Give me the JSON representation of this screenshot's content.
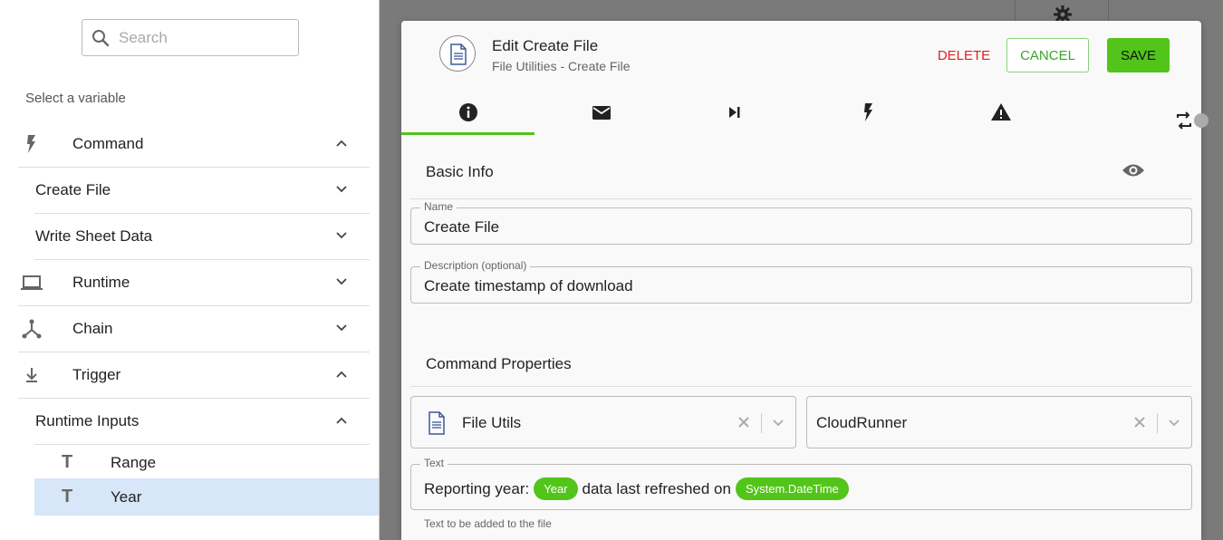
{
  "left_panel": {
    "search_placeholder": "Search",
    "select_label": "Select a variable",
    "rows": {
      "command": "Command",
      "create_file": "Create File",
      "write_sheet_data": "Write Sheet Data",
      "runtime": "Runtime",
      "chain": "Chain",
      "trigger": "Trigger",
      "runtime_inputs": "Runtime Inputs"
    },
    "leaves": {
      "range": "Range",
      "year": "Year",
      "type_glyph": "T"
    }
  },
  "modal": {
    "title": "Edit Create File",
    "subtitle": "File Utilities - Create File",
    "delete_label": "DELETE",
    "cancel_label": "CANCEL",
    "save_label": "SAVE",
    "tabs": [
      "info-icon",
      "mail-icon",
      "skip-next-icon",
      "lightning-icon",
      "warning-icon",
      "repeat-icon"
    ],
    "basic_info": {
      "title": "Basic Info",
      "name_label": "Name",
      "name_value": "Create File",
      "description_label": "Description (optional)",
      "description_value": "Create timestamp of download"
    },
    "command_properties": {
      "title": "Command Properties",
      "utility_value": "File Utils",
      "runner_value": "CloudRunner",
      "text_label": "Text",
      "text_parts": {
        "prefix": "Reporting year:",
        "pill_year": "Year",
        "middle": "data last refreshed on",
        "pill_datetime": "System.DateTime"
      },
      "helper": "Text to be added to the file"
    }
  },
  "colors": {
    "accent_green": "#52c41a",
    "delete_red": "#e02020",
    "selected_row": "#d7e6f8"
  }
}
